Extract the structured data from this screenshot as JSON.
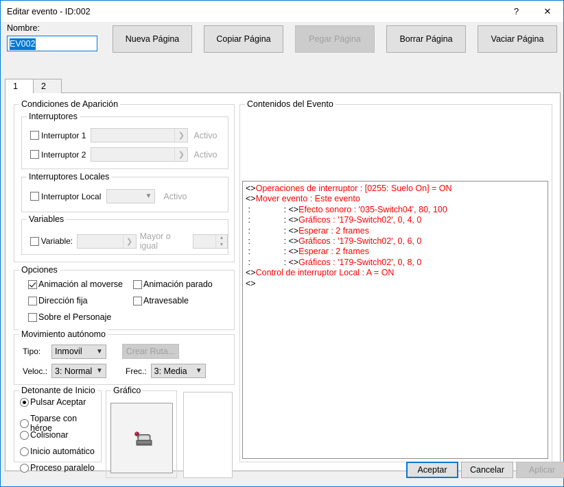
{
  "window": {
    "title": "Editar evento - ID:002",
    "help_icon": "question-mark-icon",
    "close_icon": "close-icon"
  },
  "name_field": {
    "label": "Nombre:",
    "value": "EV002"
  },
  "page_buttons": [
    {
      "label": "Nueva Página",
      "disabled": false
    },
    {
      "label": "Copiar Página",
      "disabled": false
    },
    {
      "label": "Pegar Página",
      "disabled": true
    },
    {
      "label": "Borrar Página",
      "disabled": false
    },
    {
      "label": "Vaciar Página",
      "disabled": false
    }
  ],
  "tabs": [
    {
      "label": "1",
      "active": true
    },
    {
      "label": "2",
      "active": false
    }
  ],
  "conditions": {
    "legend": "Condiciones de Aparición",
    "switches": {
      "legend": "Interruptores",
      "rows": [
        {
          "label": "Interruptor 1",
          "checked": false,
          "value": "",
          "state": "Activo"
        },
        {
          "label": "Interruptor 2",
          "checked": false,
          "value": "",
          "state": "Activo"
        }
      ]
    },
    "local_switches": {
      "legend": "Interruptores Locales",
      "row": {
        "label": "Interruptor Local",
        "checked": false,
        "value": "",
        "state": "Activo"
      }
    },
    "variables": {
      "legend": "Variables",
      "row": {
        "label": "Variable:",
        "checked": false,
        "value": "",
        "operator": "Mayor o igual",
        "number": ""
      }
    }
  },
  "options": {
    "legend": "Opciones",
    "items": [
      {
        "label": "Animación al moverse",
        "checked": true
      },
      {
        "label": "Animación parado",
        "checked": false
      },
      {
        "label": "Dirección fija",
        "checked": false
      },
      {
        "label": "Atravesable",
        "checked": false
      },
      {
        "label": "Sobre el Personaje",
        "checked": false
      }
    ]
  },
  "movement": {
    "legend": "Movimiento autónomo",
    "tipo_label": "Tipo:",
    "tipo_value": "Inmovil",
    "ruta_button": "Crear Ruta...",
    "veloc_label": "Veloc.:",
    "veloc_value": "3: Normal",
    "frec_label": "Frec.:",
    "frec_value": "3: Media"
  },
  "trigger": {
    "legend": "Detonante de Inicio",
    "items": [
      {
        "label": "Pulsar Aceptar",
        "selected": true
      },
      {
        "label": "Toparse con héroe",
        "selected": false
      },
      {
        "label": "Colisionar",
        "selected": false
      },
      {
        "label": "Inicio automático",
        "selected": false
      },
      {
        "label": "Proceso paralelo",
        "selected": false
      }
    ]
  },
  "graphic": {
    "legend": "Gráfico",
    "sprite_name": "switch-lever-sprite"
  },
  "event_contents": {
    "legend": "Contenidos del Evento",
    "lines": [
      {
        "mark": "<>",
        "text": "Operaciones de interruptor : [0255: Suelo On] = ON"
      },
      {
        "mark": "<>",
        "text": "Mover evento : Este evento"
      },
      {
        "mark": " :              : <>",
        "text": "Efecto sonoro : '035-Switch04', 80, 100"
      },
      {
        "mark": " :              : <>",
        "text": "Gráficos : '179-Switch02', 0, 4, 0"
      },
      {
        "mark": " :              : <>",
        "text": "Esperar : 2 frames"
      },
      {
        "mark": " :              : <>",
        "text": "Gráficos : '179-Switch02', 0, 6, 0"
      },
      {
        "mark": " :              : <>",
        "text": "Esperar : 2 frames"
      },
      {
        "mark": " :              : <>",
        "text": "Gráficos : '179-Switch02', 0, 8, 0"
      },
      {
        "mark": "<>",
        "text": "Control de interruptor Local : A = ON"
      },
      {
        "mark": "<>",
        "text": ""
      }
    ]
  },
  "footer": {
    "accept": "Aceptar",
    "cancel": "Cancelar",
    "apply": "Aplicar",
    "apply_disabled": true
  },
  "colors": {
    "accent": "#0078d7",
    "event_text": "#ff0000",
    "window_bg": "#f0f0f0",
    "panel_bg": "#ffffff"
  }
}
